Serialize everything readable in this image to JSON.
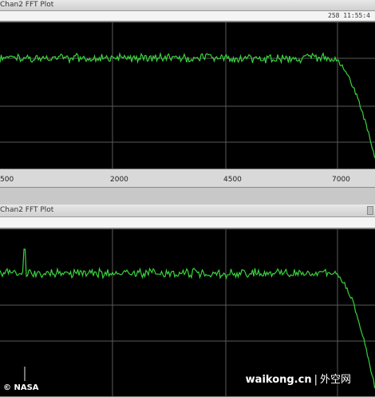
{
  "panels": [
    {
      "title": "Chan2 FFT Plot",
      "status": "258  11:55:4",
      "x_ticks": [
        "500",
        "2000",
        "4500",
        "7000"
      ]
    },
    {
      "title": "Chan2 FFT Plot"
    }
  ],
  "colors": {
    "trace": "#39d23c",
    "grid": "#5a5a5a",
    "plot_bg": "#000000"
  },
  "watermark": {
    "site": "waikong.cn",
    "sep": "|",
    "cn": "外空网"
  },
  "credit": "© NASA"
}
